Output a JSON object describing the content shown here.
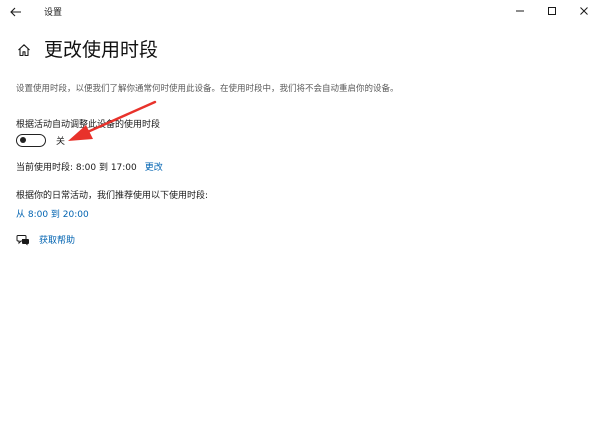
{
  "titlebar": {
    "app_title": "设置"
  },
  "header": {
    "title": "更改使用时段"
  },
  "description": "设置使用时段，以便我们了解你通常何时使用此设备。在使用时段中，我们将不会自动重启你的设备。",
  "auto_adjust": {
    "label": "根据活动自动调整此设备的使用时段",
    "state_label": "关",
    "state": "off"
  },
  "current_hours": {
    "text": "当前使用时段: 8:00 到 17:00",
    "change_link": "更改"
  },
  "suggestion": {
    "label": "根据你的日常活动，我们推荐使用以下使用时段:",
    "link": "从 8:00 到 20:00"
  },
  "help": {
    "label": "获取帮助"
  },
  "colors": {
    "link": "#0063b1",
    "annotation_arrow": "#e8322b"
  },
  "icons": {
    "back": "back-arrow-icon",
    "home": "home-icon",
    "minimize": "minimize-icon",
    "maximize": "maximize-icon",
    "close": "close-icon",
    "help": "chat-help-icon"
  }
}
